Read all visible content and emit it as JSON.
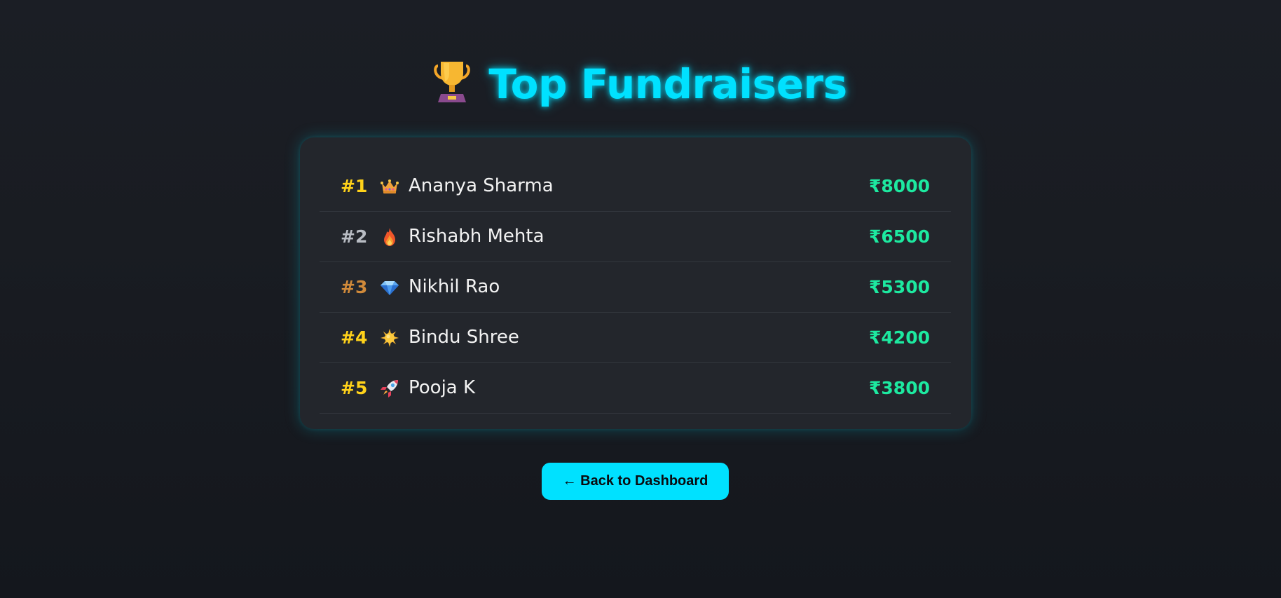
{
  "header": {
    "title": "Top Fundraisers",
    "icon": "trophy-icon"
  },
  "leaderboard": {
    "entries": [
      {
        "rank": "#1",
        "icon": "crown-icon",
        "name": "Ananya Sharma",
        "amount": "₹8000",
        "rank_color": "#ffd21a"
      },
      {
        "rank": "#2",
        "icon": "fire-icon",
        "name": "Rishabh Mehta",
        "amount": "₹6500",
        "rank_color": "#b8bcc3"
      },
      {
        "rank": "#3",
        "icon": "gem-icon",
        "name": "Nikhil Rao",
        "amount": "₹5300",
        "rank_color": "#d18a3a"
      },
      {
        "rank": "#4",
        "icon": "star-burst-icon",
        "name": "Bindu Shree",
        "amount": "₹4200",
        "rank_color": "#ffd21a"
      },
      {
        "rank": "#5",
        "icon": "rocket-icon",
        "name": "Pooja K",
        "amount": "₹3800",
        "rank_color": "#ffd21a"
      }
    ]
  },
  "footer": {
    "back_label": "← Back to Dashboard"
  },
  "colors": {
    "accent": "#00e1ff",
    "amount": "#1de9a0",
    "background": "#1a1d23",
    "card": "#23262c"
  }
}
